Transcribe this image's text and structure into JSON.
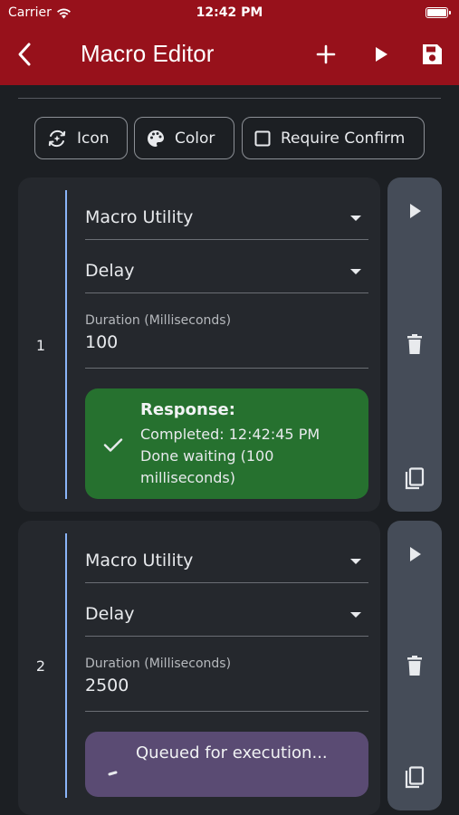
{
  "status_bar": {
    "carrier": "Carrier",
    "time": "12:42 PM"
  },
  "app_bar": {
    "title": "Macro Editor"
  },
  "options": {
    "icon_label": "Icon",
    "color_label": "Color",
    "require_confirm_label": "Require Confirm"
  },
  "steps": [
    {
      "number": "1",
      "category": "Macro Utility",
      "action": "Delay",
      "duration_label": "Duration (Milliseconds)",
      "duration_value": "100",
      "response_title": "Response:",
      "response_line1": "Completed: 12:42:45 PM",
      "response_line2": "Done waiting (100",
      "response_line3": "milliseconds)"
    },
    {
      "number": "2",
      "category": "Macro Utility",
      "action": "Delay",
      "duration_label": "Duration (Milliseconds)",
      "duration_value": "2500",
      "queued_text": "Queued for execution..."
    }
  ],
  "colors": {
    "app_bar": "#97111b",
    "background": "#1c1f23",
    "card": "#25282d",
    "side_panel": "#454c58",
    "success": "#26712f",
    "queued": "#5a4b73",
    "accent_line": "#8ab4f8"
  }
}
